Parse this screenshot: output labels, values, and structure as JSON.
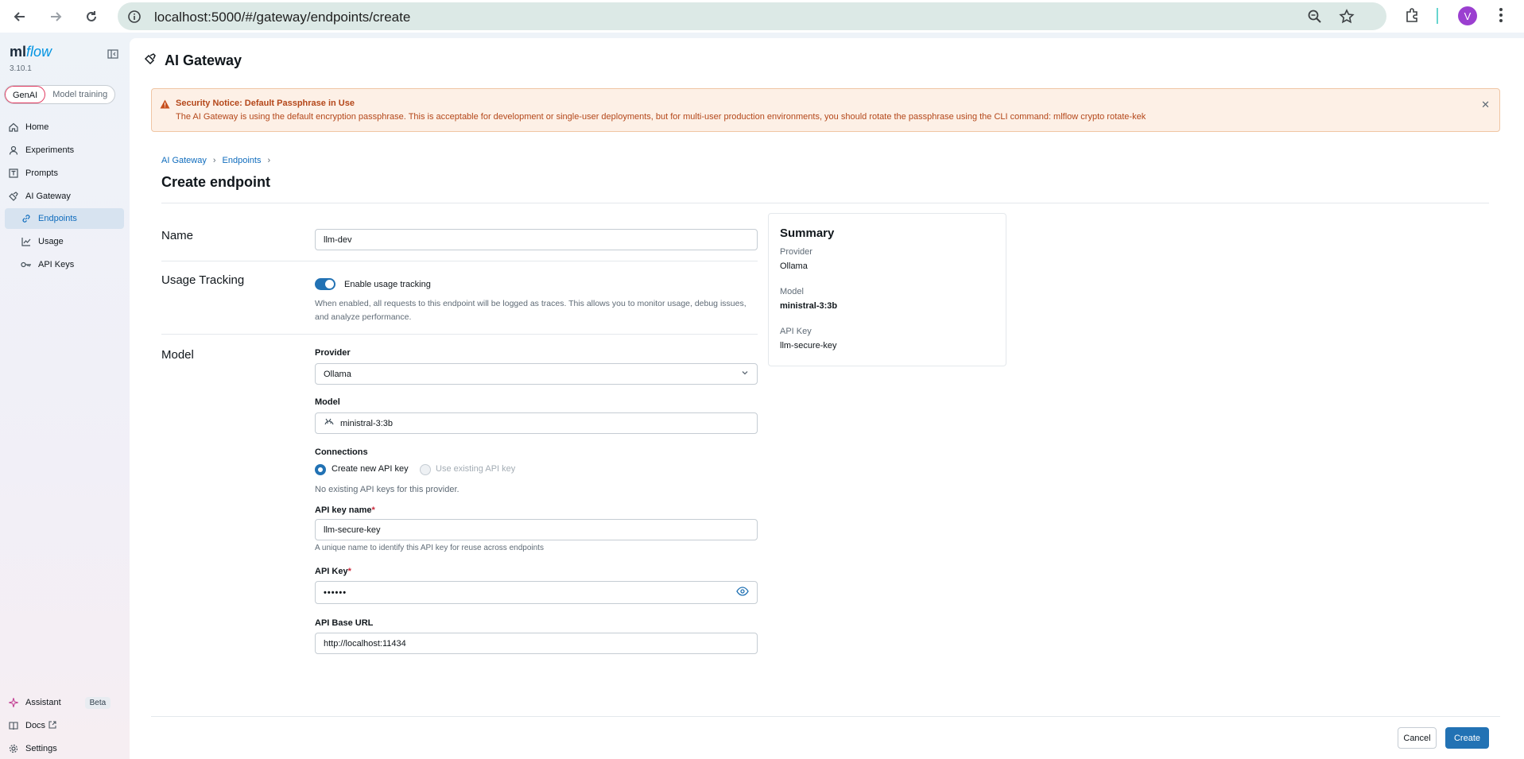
{
  "browser": {
    "url": "localhost:5000/#/gateway/endpoints/create",
    "profile_initial": "V"
  },
  "sidebar": {
    "logo_ml": "ml",
    "logo_flow": "flow",
    "version": "3.10.1",
    "segments": [
      "GenAI",
      "Model training"
    ],
    "items": [
      {
        "label": "Home",
        "icon": "home-icon"
      },
      {
        "label": "Experiments",
        "icon": "flask-icon"
      },
      {
        "label": "Prompts",
        "icon": "prompt-icon"
      },
      {
        "label": "AI Gateway",
        "icon": "gateway-icon"
      },
      {
        "label": "Endpoints",
        "icon": "link-icon"
      },
      {
        "label": "Usage",
        "icon": "chart-icon"
      },
      {
        "label": "API Keys",
        "icon": "key-icon"
      }
    ],
    "bottom": [
      {
        "label": "Assistant",
        "icon": "sparkle-icon",
        "badge": "Beta"
      },
      {
        "label": "Docs",
        "icon": "book-icon"
      },
      {
        "label": "Settings",
        "icon": "gear-icon"
      }
    ]
  },
  "header": {
    "title": "AI Gateway"
  },
  "alert": {
    "title": "Security Notice: Default Passphrase in Use",
    "message": "The AI Gateway is using the default encryption passphrase. This is acceptable for development or single-user deployments, but for multi-user production environments, you should rotate the passphrase using the CLI command: mlflow crypto rotate-kek"
  },
  "breadcrumb": [
    "AI Gateway",
    "Endpoints"
  ],
  "page_title": "Create endpoint",
  "form": {
    "name_section": "Name",
    "name_value": "llm-dev",
    "usage_section": "Usage Tracking",
    "usage_toggle_label": "Enable usage tracking",
    "usage_help": "When enabled, all requests to this endpoint will be logged as traces. This allows you to monitor usage, debug issues,",
    "usage_help2": "and analyze performance.",
    "model_section": "Model",
    "provider_label": "Provider",
    "provider_value": "Ollama",
    "model_label": "Model",
    "model_value": "ministral-3:3b",
    "connections_label": "Connections",
    "radio_new": "Create new API key",
    "radio_existing": "Use existing API key",
    "no_keys_text": "No existing API keys for this provider.",
    "api_key_name_label": "API key name",
    "api_key_name_value": "llm-secure-key",
    "api_key_name_help": "A unique name to identify this API key for reuse across endpoints",
    "api_key_label": "API Key",
    "api_key_value": "••••••",
    "base_url_label": "API Base URL",
    "base_url_value": "http://localhost:11434",
    "required_mark": "*"
  },
  "summary": {
    "title": "Summary",
    "provider_label": "Provider",
    "provider_value": "Ollama",
    "model_label": "Model",
    "model_value": "ministral-3:3b",
    "api_key_label": "API Key",
    "api_key_value": "llm-secure-key"
  },
  "footer": {
    "cancel": "Cancel",
    "create": "Create"
  },
  "colors": {
    "primary": "#2272b4",
    "alert_text": "#b4471a",
    "link": "#0f6cbd"
  }
}
